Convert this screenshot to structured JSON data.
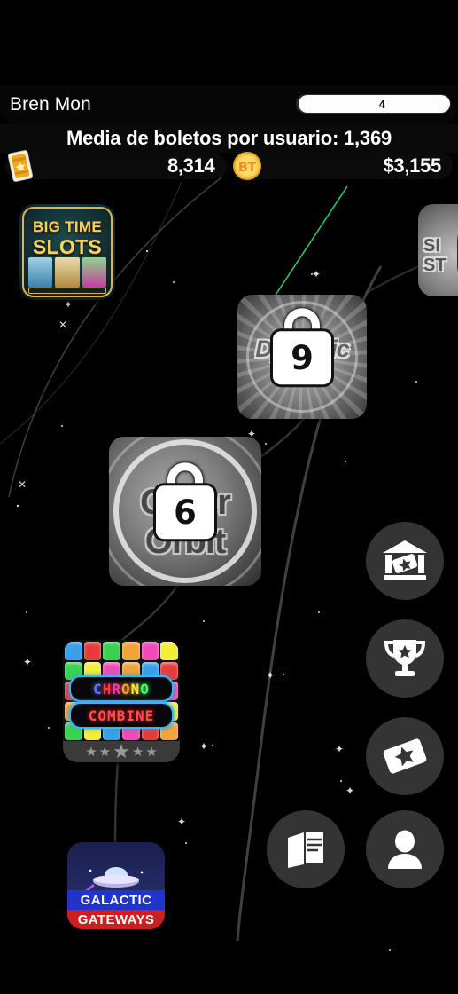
{
  "header": {
    "username": "Bren Mon",
    "level": "4",
    "level_progress_percent": 88,
    "average_tickets_label": "Media de boletos por usuario: 1,369",
    "currencies": [
      {
        "name": "tickets",
        "icon": "ticket-icon",
        "value": "8,314"
      },
      {
        "name": "coins",
        "icon": "coin-icon",
        "value": "$3,155"
      }
    ]
  },
  "map": {
    "tiles": [
      {
        "id": "big-time-slots",
        "title_line1": "BIG TIME",
        "title_line2": "SLOTS",
        "locked": false,
        "lock_number": ""
      },
      {
        "id": "side-game",
        "title_line1": "SI",
        "title_line2": "ST",
        "locked": true,
        "lock_number": ""
      },
      {
        "id": "dynamic-dash",
        "title_line1": "Dynamic",
        "title_line2": "",
        "locked": true,
        "lock_number": "9"
      },
      {
        "id": "outer-orbit",
        "title_line1": "Outer",
        "title_line2": "Orbit",
        "locked": true,
        "lock_number": "6"
      },
      {
        "id": "chrono-combine",
        "title_line1": "CHRONO",
        "title_line2": "COMBINE",
        "locked": false,
        "lock_number": ""
      },
      {
        "id": "galactic-gateways",
        "title_line1": "GALACTIC",
        "title_line2": "GATEWAYS",
        "locked": false,
        "lock_number": ""
      }
    ]
  },
  "actions": [
    {
      "name": "prize-bank-button",
      "icon": "bank-ticket-icon"
    },
    {
      "name": "leaderboard-button",
      "icon": "trophy-icon"
    },
    {
      "name": "tickets-button",
      "icon": "ticket-star-icon"
    },
    {
      "name": "news-button",
      "icon": "book-icon"
    },
    {
      "name": "profile-button",
      "icon": "person-icon"
    }
  ],
  "colors": {
    "background": "#000000",
    "bar_fill": "#fdfdfd",
    "gold": "#f7d366",
    "coin": "#f4b731",
    "neon_blue": "#39b6ef",
    "neon_red": "#ff4d4d",
    "fab_bg": "#343434"
  },
  "chrono_gem_colors": [
    "#3aa0e8",
    "#e83a3a",
    "#3ad14f",
    "#f2a33a",
    "#ef4bb8",
    "#f2ef3a",
    "#3ad14f",
    "#f2ef3a",
    "#ef4bb8",
    "#f2a33a",
    "#3aa0e8",
    "#e83a3a",
    "#e83a3a",
    "#3aa0e8",
    "#f2a33a",
    "#3ad14f",
    "#f2ef3a",
    "#ef4bb8",
    "#f2a33a",
    "#ef4bb8",
    "#e83a3a",
    "#3aa0e8",
    "#3ad14f",
    "#f2ef3a",
    "#3ad14f",
    "#f2ef3a",
    "#3aa0e8",
    "#ef4bb8",
    "#e83a3a",
    "#f2a33a",
    "#3aa0e8",
    "#e83a3a",
    "#3ad14f",
    "#f2a33a",
    "#f2ef3a",
    "#3ad14f"
  ],
  "chrono_letter_colors": [
    "#5b7bff",
    "#ff3a3a",
    "#ff3aa8",
    "#ff9a2a",
    "#ffe63a",
    "#3aff6a"
  ]
}
